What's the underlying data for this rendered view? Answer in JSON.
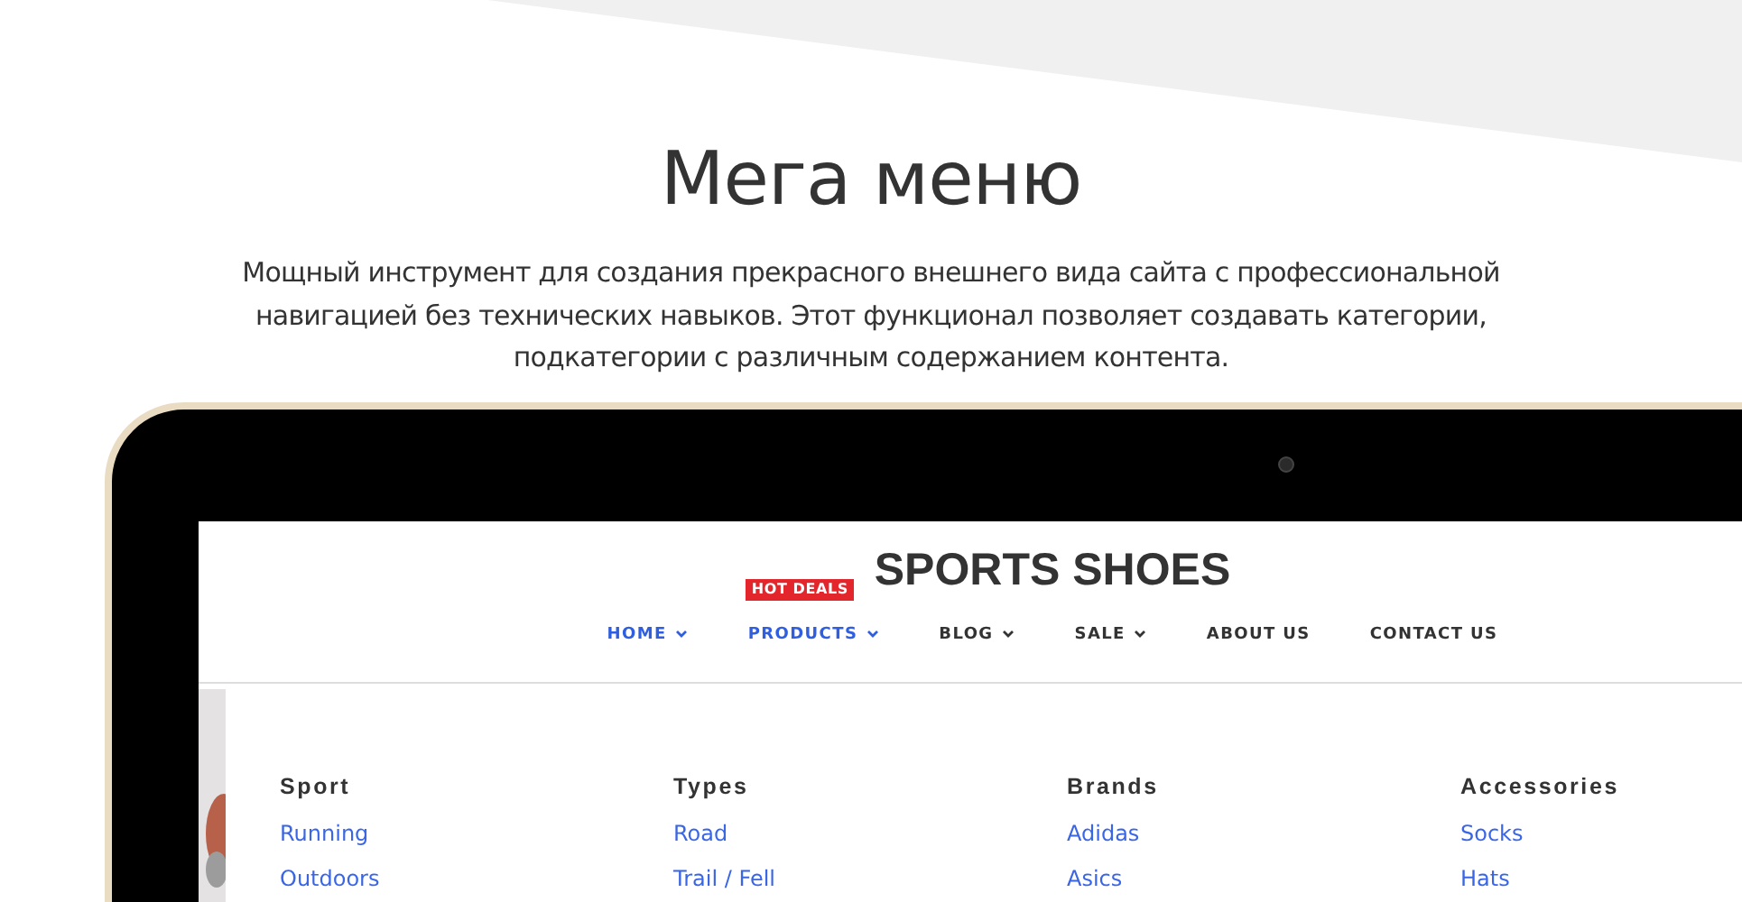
{
  "heading": "Мега меню",
  "description": "Мощный инструмент для создания прекрасного внешнего вида сайта с профессиональной навигацией без технических навыков. Этот функционал позволяет создавать категории, подкатегории с различным содержанием контента.",
  "site": {
    "logo": "SPORTS SHOES",
    "nav": [
      {
        "label": "HOME",
        "selected": true,
        "dropdown": true
      },
      {
        "label": "PRODUCTS",
        "selected": true,
        "dropdown": true,
        "badge": "HOT DEALS"
      },
      {
        "label": "BLOG",
        "selected": false,
        "dropdown": true
      },
      {
        "label": "SALE",
        "selected": false,
        "dropdown": true
      },
      {
        "label": "ABOUT US",
        "selected": false,
        "dropdown": false
      },
      {
        "label": "CONTACT US",
        "selected": false,
        "dropdown": false
      }
    ],
    "mega_menu": [
      {
        "title": "Sport",
        "links": [
          "Running",
          "Outdoors"
        ]
      },
      {
        "title": "Types",
        "links": [
          "Road",
          "Trail / Fell"
        ]
      },
      {
        "title": "Brands",
        "links": [
          "Adidas",
          "Asics"
        ]
      },
      {
        "title": "Accessories",
        "links": [
          "Socks",
          "Hats"
        ]
      }
    ]
  }
}
